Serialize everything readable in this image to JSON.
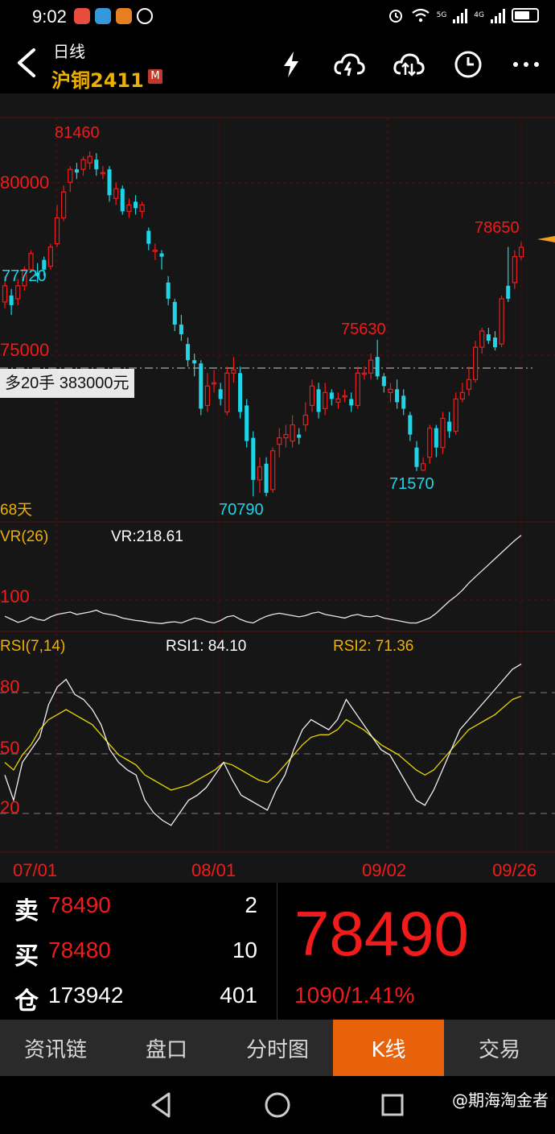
{
  "status": {
    "time": "9:02",
    "net1": "5G",
    "net2": "4G"
  },
  "header": {
    "period": "日线",
    "symbol": "沪铜2411",
    "badge": "M"
  },
  "chart": {
    "price_labels": {
      "high": "81460",
      "y80000": "80000",
      "left_low": "77720",
      "y75000": "75000",
      "peak2": "75630",
      "low1": "70790",
      "low2": "71570",
      "last_high": "78650"
    },
    "position_tag": "多20手  383000元",
    "days": "68天",
    "vr": {
      "name": "VR(26)",
      "value_label": "VR:218.61",
      "level": "100"
    },
    "rsi": {
      "name": "RSI(7,14)",
      "rsi1_label": "RSI1: 84.10",
      "rsi2_label": "RSI2: 71.36",
      "levels": [
        "80",
        "50",
        "20"
      ]
    },
    "dates": [
      "07/01",
      "08/01",
      "09/02",
      "09/26"
    ]
  },
  "chart_data": {
    "type": "candlestick",
    "price_range": [
      70000,
      82500
    ],
    "candles": [
      [
        76800,
        77300,
        77600,
        76600
      ],
      [
        77000,
        76700,
        77200,
        76400
      ],
      [
        76900,
        77300,
        77500,
        76700
      ],
      [
        77300,
        77800,
        77900,
        77150
      ],
      [
        77800,
        78300,
        78400,
        77720
      ],
      [
        77700,
        77600,
        78000,
        77400
      ],
      [
        78100,
        77800,
        78200,
        77600
      ],
      [
        77900,
        78500,
        78600,
        77800
      ],
      [
        78600,
        79400,
        79800,
        78500
      ],
      [
        79400,
        80200,
        80400,
        79300
      ],
      [
        80500,
        80900,
        81000,
        80200
      ],
      [
        80900,
        80800,
        81100,
        80600
      ],
      [
        80900,
        81200,
        81300,
        80700
      ],
      [
        81100,
        81300,
        81460,
        80900
      ],
      [
        81200,
        80900,
        81400,
        80700
      ],
      [
        80800,
        80800,
        81000,
        80600
      ],
      [
        80900,
        80100,
        81000,
        79900
      ],
      [
        80000,
        80300,
        80500,
        79800
      ],
      [
        80300,
        79600,
        80400,
        79500
      ],
      [
        79600,
        79800,
        80000,
        79400
      ],
      [
        79900,
        79700,
        80100,
        79500
      ],
      [
        79600,
        79800,
        79900,
        79400
      ],
      [
        79000,
        78600,
        79100,
        78400
      ],
      [
        78400,
        78400,
        78600,
        78100
      ],
      [
        78300,
        78200,
        78400,
        77800
      ],
      [
        77400,
        76900,
        77600,
        76700
      ],
      [
        76800,
        76100,
        76900,
        75900
      ],
      [
        76100,
        75800,
        76400,
        75600
      ],
      [
        75500,
        75000,
        75700,
        74800
      ],
      [
        75000,
        74900,
        75200,
        74500
      ],
      [
        74900,
        73500,
        75000,
        73300
      ],
      [
        73600,
        74200,
        74600,
        73400
      ],
      [
        74300,
        74300,
        74700,
        74000
      ],
      [
        74100,
        73800,
        74300,
        73600
      ],
      [
        73400,
        74600,
        74800,
        73300
      ],
      [
        74600,
        74700,
        75100,
        74300
      ],
      [
        74600,
        73400,
        74800,
        73200
      ],
      [
        73600,
        72500,
        73800,
        72300
      ],
      [
        72600,
        71300,
        72800,
        70790
      ],
      [
        71300,
        71700,
        72000,
        70900
      ],
      [
        71800,
        70900,
        72000,
        70790
      ],
      [
        71000,
        72200,
        72300,
        70900
      ],
      [
        72400,
        72600,
        72900,
        72000
      ],
      [
        72600,
        72700,
        73000,
        72300
      ],
      [
        72500,
        73000,
        73300,
        72300
      ],
      [
        72700,
        72600,
        72900,
        72400
      ],
      [
        73000,
        73300,
        73700,
        72800
      ],
      [
        73600,
        74200,
        74400,
        73400
      ],
      [
        74100,
        73400,
        74300,
        73200
      ],
      [
        73500,
        74000,
        74300,
        73300
      ],
      [
        74000,
        73800,
        74100,
        73600
      ],
      [
        73700,
        73800,
        74000,
        73500
      ],
      [
        73900,
        73900,
        74100,
        73700
      ],
      [
        73800,
        73600,
        74000,
        73400
      ],
      [
        73600,
        74600,
        74800,
        73500
      ],
      [
        74600,
        74600,
        74800,
        74400
      ],
      [
        74600,
        75000,
        75200,
        74400
      ],
      [
        75100,
        74500,
        75630,
        74400
      ],
      [
        74500,
        74200,
        74600,
        74000
      ],
      [
        74000,
        74100,
        74300,
        73700
      ],
      [
        74100,
        73700,
        74400,
        73500
      ],
      [
        73900,
        73500,
        74100,
        73300
      ],
      [
        73300,
        72700,
        73400,
        72500
      ],
      [
        72300,
        71700,
        72500,
        71570
      ],
      [
        71600,
        71800,
        72000,
        71570
      ],
      [
        72000,
        72900,
        73000,
        71800
      ],
      [
        72900,
        72300,
        73000,
        72000
      ],
      [
        72300,
        73200,
        73400,
        72100
      ],
      [
        73100,
        72800,
        73400,
        72600
      ],
      [
        72800,
        73800,
        74000,
        72700
      ],
      [
        73800,
        74000,
        74300,
        73700
      ],
      [
        74100,
        74400,
        74800,
        73900
      ],
      [
        74400,
        75400,
        75600,
        74300
      ],
      [
        75400,
        75900,
        76000,
        75200
      ],
      [
        75800,
        75600,
        76000,
        75500
      ],
      [
        75700,
        75400,
        75900,
        75300
      ],
      [
        75500,
        76900,
        77000,
        75400
      ],
      [
        77300,
        76900,
        78500,
        76800
      ],
      [
        77400,
        78200,
        78400,
        77200
      ],
      [
        78200,
        78490,
        78650,
        78100
      ]
    ],
    "vr_series": [
      85,
      80,
      75,
      78,
      84,
      80,
      78,
      84,
      88,
      90,
      92,
      88,
      90,
      92,
      95,
      90,
      88,
      86,
      82,
      80,
      78,
      77,
      75,
      74,
      73,
      75,
      76,
      74,
      78,
      82,
      80,
      76,
      74,
      78,
      84,
      86,
      80,
      76,
      74,
      80,
      85,
      88,
      90,
      88,
      86,
      84,
      86,
      90,
      92,
      88,
      86,
      84,
      82,
      86,
      88,
      85,
      84,
      86,
      82,
      80,
      78,
      76,
      74,
      74,
      78,
      82,
      90,
      100,
      110,
      118,
      128,
      140,
      150,
      160,
      170,
      180,
      190,
      200,
      210,
      218.61
    ],
    "rsi1_series": [
      40,
      30,
      45,
      50,
      55,
      68,
      75,
      78,
      72,
      70,
      66,
      60,
      50,
      45,
      42,
      40,
      30,
      25,
      22,
      20,
      25,
      30,
      32,
      35,
      40,
      45,
      38,
      32,
      30,
      28,
      26,
      34,
      40,
      50,
      58,
      62,
      60,
      58,
      62,
      70,
      65,
      60,
      55,
      50,
      48,
      42,
      36,
      30,
      28,
      34,
      42,
      50,
      58,
      62,
      66,
      70,
      74,
      78,
      82,
      84.1
    ],
    "rsi2_series": [
      45,
      42,
      48,
      52,
      58,
      62,
      64,
      66,
      64,
      62,
      60,
      56,
      52,
      48,
      46,
      44,
      40,
      38,
      36,
      34,
      35,
      36,
      38,
      40,
      42,
      45,
      44,
      42,
      40,
      38,
      37,
      40,
      44,
      48,
      52,
      55,
      56,
      56,
      58,
      62,
      60,
      58,
      55,
      52,
      50,
      48,
      45,
      42,
      40,
      42,
      46,
      50,
      54,
      58,
      60,
      62,
      64,
      67,
      70,
      71.36
    ],
    "rsi_range": [
      10,
      90
    ],
    "last_price": 78490
  },
  "quote": {
    "sell_label": "卖",
    "sell_price": "78490",
    "sell_vol": "2",
    "buy_label": "买",
    "buy_price": "78480",
    "buy_vol": "10",
    "oi_label": "仓",
    "oi_value": "173942",
    "oi_change": "401",
    "price": "78490",
    "change": "1090/1.41%"
  },
  "tabs": [
    "资讯链",
    "盘口",
    "分时图",
    "K线",
    "交易"
  ],
  "active_tab": 3,
  "watermark": "@期海淘金者",
  "colors": {
    "up": "#f21b1b",
    "down": "#1ed4e6",
    "accent": "#e8620c",
    "symbol": "#f0b000",
    "rsi2": "#e6d600"
  }
}
